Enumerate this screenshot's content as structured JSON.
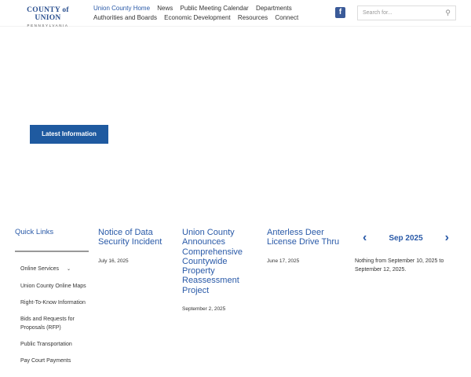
{
  "header": {
    "logo_main": "COUNTY of UNION",
    "logo_sub": "PENNSYLVANIA",
    "nav": [
      "Union County Home",
      "News",
      "Public Meeting Calendar",
      "Departments",
      "Authorities and Boards",
      "Economic Development",
      "Resources",
      "Connect"
    ],
    "search_placeholder": "Search for..."
  },
  "hero": {
    "button": "Latest Information"
  },
  "quick_links": {
    "title": "Quick Links",
    "items": [
      "Online Services",
      "Union County Online Maps",
      "Right-To-Know Information",
      "Bids and Requests for Proposals (RFP)",
      "Public Transportation",
      "Pay Court Payments"
    ]
  },
  "news": [
    {
      "title": "Notice of Data Security Incident",
      "date": "July 16, 2025"
    },
    {
      "title": "Union County Announces Comprehensive Countywide Property Reassessment Project",
      "date": "September 2, 2025"
    },
    {
      "title": "Anterless Deer License Drive Thru",
      "date": "June 17, 2025"
    }
  ],
  "calendar": {
    "month": "Sep 2025",
    "message": "Nothing from September 10, 2025 to September 12, 2025."
  }
}
